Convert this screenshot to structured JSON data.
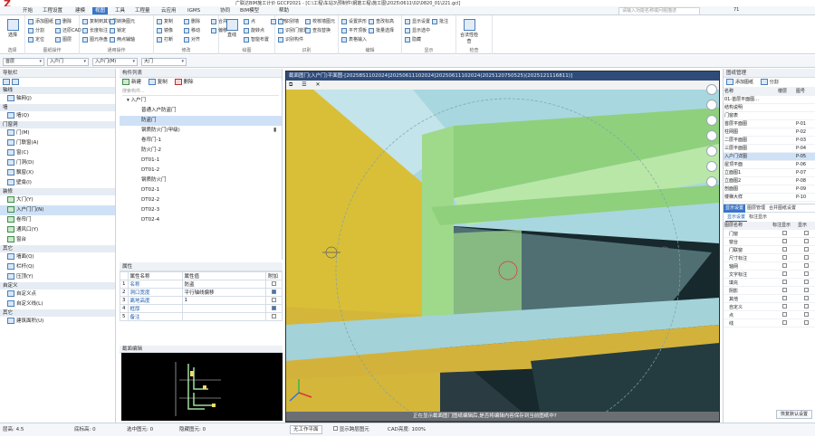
{
  "window": {
    "title": "广联达BIM施工计价 GCCP2021 - [C:\\工程\\车站3\\预制件\\钢筋工程\\施工图\\2025\\0611\\02\\0820_01\\221.gcl]",
    "logo": "Z",
    "search_placeholder": "请输入功能名称或问题描述",
    "top_right_label": "71"
  },
  "tabs": [
    "开始",
    "工程设置",
    "建模",
    "视图",
    "工具",
    "工程量",
    "云应用",
    "IGMS",
    "协同",
    "BIM模型",
    "帮助"
  ],
  "active_tab": "视图",
  "ribbon": {
    "groups": [
      {
        "label": "选择",
        "big": "选择",
        "small": []
      },
      {
        "label": "图纸操作",
        "small": [
          "添加图纸",
          "分割",
          "定位",
          "删除",
          "还原CAD",
          "图层"
        ]
      },
      {
        "label": "通用操作",
        "small": [
          "复制到其它层",
          "长度标注",
          "图元存盘",
          "转换图元",
          "锁定",
          "两点辅轴"
        ]
      },
      {
        "label": "修改",
        "small": [
          "复制",
          "镜像",
          "打断",
          "删除",
          "移动",
          "对齐",
          "合并",
          "偏移"
        ]
      },
      {
        "label": "绘图",
        "big": "直线",
        "small": [
          "点",
          "旋转点",
          "智能布置",
          "矩形"
        ]
      },
      {
        "label": "识别",
        "small": [
          "识别墙",
          "识别门窗洞",
          "识别构件",
          "校核墙图元",
          "查找替换"
        ]
      },
      {
        "label": "编辑",
        "small": [
          "设置拱形",
          "平齐顶板",
          "表格输入",
          "查改标高",
          "批量选择"
        ]
      },
      {
        "label": "显示",
        "small": [
          "显示设置",
          "显示选中",
          "隐藏",
          "批注"
        ]
      },
      {
        "label": "检查",
        "big": "合法性检查",
        "small": []
      }
    ]
  },
  "toolbar": {
    "floor": "首层",
    "category": "入户门",
    "type": "入户门(M)",
    "component": "大门"
  },
  "nav": {
    "header": "导航栏",
    "categories": [
      {
        "name": "轴线",
        "items": [
          "轴网(J)"
        ]
      },
      {
        "name": "墙",
        "items": [
          "墙(Q)"
        ]
      },
      {
        "name": "门窗洞",
        "items": [
          "门(M)",
          "门联窗(A)",
          "窗(C)",
          "门洞(D)",
          "飘窗(X)",
          "壁龛(I)"
        ]
      },
      {
        "name": "装修",
        "items": [
          "大门(Y)",
          "入户门门(N)",
          "卷帘门",
          "通风口(Y)",
          "窗台"
        ]
      },
      {
        "name": "其它",
        "items": [
          "墙面(Q)",
          "栏杆(Q)",
          "压顶(Y)"
        ]
      },
      {
        "name": "自定义",
        "items": [
          "自定义点",
          "自定义线(L)"
        ]
      },
      {
        "name": "其它",
        "items": [
          "建筑面积(U)"
        ]
      }
    ],
    "selected": "入户门门(N)"
  },
  "components": {
    "header": "构件列表",
    "new": "新建",
    "copy": "复制",
    "delete": "删除",
    "search_placeholder": "搜索构件...",
    "group": "入户门",
    "items": [
      "普通入户防盗门",
      "防盗门",
      "钢质防火门(甲级)",
      "卷帘门-1",
      "防火门-2",
      "DT01-1",
      "DT01-2",
      "钢质防火门",
      "DT02-1",
      "DT02-2",
      "DT02-3",
      "DT02-4"
    ],
    "selected": "防盗门"
  },
  "properties": {
    "header": "属性",
    "columns": [
      "属性名称",
      "属性值",
      "附加"
    ],
    "rows": [
      {
        "no": "1",
        "name": "名称",
        "value": "防盗",
        "flag": false
      },
      {
        "no": "2",
        "name": "洞口宽度",
        "value": "平行轴线偏移",
        "flag": true
      },
      {
        "no": "3",
        "name": "离地高度",
        "value": "1",
        "flag": false
      },
      {
        "no": "4",
        "name": "框厚",
        "value": "",
        "flag": true
      },
      {
        "no": "5",
        "name": "备注",
        "value": "",
        "flag": false
      }
    ]
  },
  "section": {
    "header": "截面编辑"
  },
  "viewport": {
    "title": "截面图门(入户门)平面图-[2025BS1102024]20250611102024]20250611102024(2025120750525)(2025121116811)]",
    "status": "正在显示截面图门图纸编辑后,是否将编辑内容保存到当前图纸中?"
  },
  "right_panel": {
    "header": "图纸管理",
    "add": "添加图纸",
    "split": "分割",
    "cols": [
      "名称",
      "楼层",
      "图号"
    ],
    "rows": [
      {
        "name": "01-首层平面图...",
        "floor": "",
        "code": ""
      },
      {
        "name": "结构说明",
        "floor": "",
        "code": ""
      },
      {
        "name": "门窗表",
        "floor": "",
        "code": ""
      },
      {
        "name": "首层平面图",
        "floor": "",
        "code": "P-01"
      },
      {
        "name": "柱网图",
        "floor": "",
        "code": "P-02"
      },
      {
        "name": "二层平面图",
        "floor": "",
        "code": "P-03"
      },
      {
        "name": "三层平面图",
        "floor": "",
        "code": "P-04"
      },
      {
        "name": "入户门详图",
        "floor": "",
        "code": "P-05"
      },
      {
        "name": "屋顶平面",
        "floor": "",
        "code": "P-06"
      },
      {
        "name": "立面图1",
        "floor": "",
        "code": "P-07"
      },
      {
        "name": "立面图2",
        "floor": "",
        "code": "P-08"
      },
      {
        "name": "剖面图",
        "floor": "",
        "code": "P-09"
      },
      {
        "name": "楼梯大样",
        "floor": "",
        "code": "P-10"
      }
    ],
    "selected": "入户门详图",
    "tabs2": [
      "显示设置",
      "图层管理",
      "合并图纸设置"
    ],
    "subtabs": [
      "显示设置",
      "标注显示"
    ],
    "grid_cols": [
      "图层名称",
      "标注显示",
      "显示"
    ],
    "grid_rows": [
      {
        "name": "门窗"
      },
      {
        "name": "窗台"
      },
      {
        "name": "门联窗"
      },
      {
        "name": "尺寸标注"
      },
      {
        "name": "轴网"
      },
      {
        "name": "文字标注"
      },
      {
        "name": "填充"
      },
      {
        "name": "阴影"
      },
      {
        "name": "其他"
      },
      {
        "name": "自定义"
      },
      {
        "name": "点"
      },
      {
        "name": "线"
      }
    ],
    "reset": "恢复默认设置"
  },
  "statusbar": {
    "floor_height": "层高: 4.5",
    "base_height": "底标高: 0",
    "selected": "选中图元: 0",
    "hidden": "隐藏图元: 0",
    "mode": "无工作平面",
    "cad_label": "显示跨层图元",
    "cad_brightness": "CAD亮度: 100%"
  }
}
